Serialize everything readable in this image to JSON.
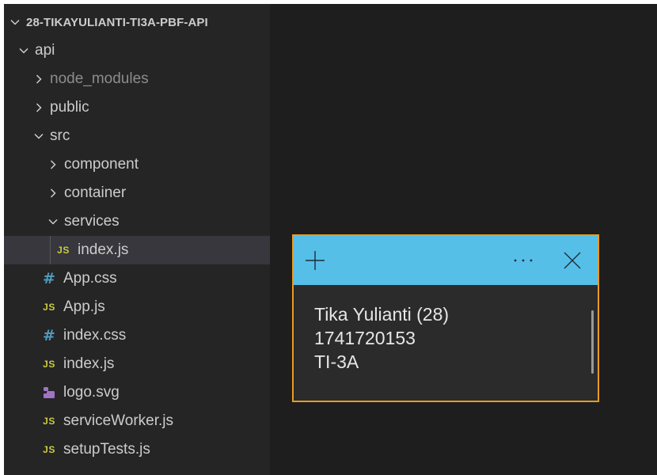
{
  "explorer": {
    "items": [
      {
        "label": "28-TIKAYULIANTI-TI3A-PBF-API",
        "type": "folder",
        "expanded": true
      },
      {
        "label": "api",
        "type": "folder",
        "expanded": true
      },
      {
        "label": "node_modules",
        "type": "folder",
        "expanded": false
      },
      {
        "label": "public",
        "type": "folder",
        "expanded": false
      },
      {
        "label": "src",
        "type": "folder",
        "expanded": true
      },
      {
        "label": "component",
        "type": "folder",
        "expanded": false
      },
      {
        "label": "container",
        "type": "folder",
        "expanded": false
      },
      {
        "label": "services",
        "type": "folder",
        "expanded": true
      },
      {
        "label": "index.js",
        "type": "js",
        "badge": "JS"
      },
      {
        "label": "App.css",
        "type": "css",
        "badge": "#"
      },
      {
        "label": "App.js",
        "type": "js",
        "badge": "JS"
      },
      {
        "label": "index.css",
        "type": "css",
        "badge": "#"
      },
      {
        "label": "index.js",
        "type": "js",
        "badge": "JS"
      },
      {
        "label": "logo.svg",
        "type": "svg"
      },
      {
        "label": "serviceWorker.js",
        "type": "js",
        "badge": "JS"
      },
      {
        "label": "setupTests.js",
        "type": "js",
        "badge": "JS"
      }
    ]
  },
  "sticky_note": {
    "lines": [
      "Tika Yulianti (28)",
      "1741720153",
      "TI-3A"
    ],
    "header_color": "#55bfe8",
    "border_color": "#e89b24"
  },
  "colors": {
    "editor_bg": "#1e1e1e",
    "sidebar_bg": "#252526",
    "selected_row": "#37373d",
    "js_icon": "#cbcb41",
    "css_icon": "#519aba"
  }
}
